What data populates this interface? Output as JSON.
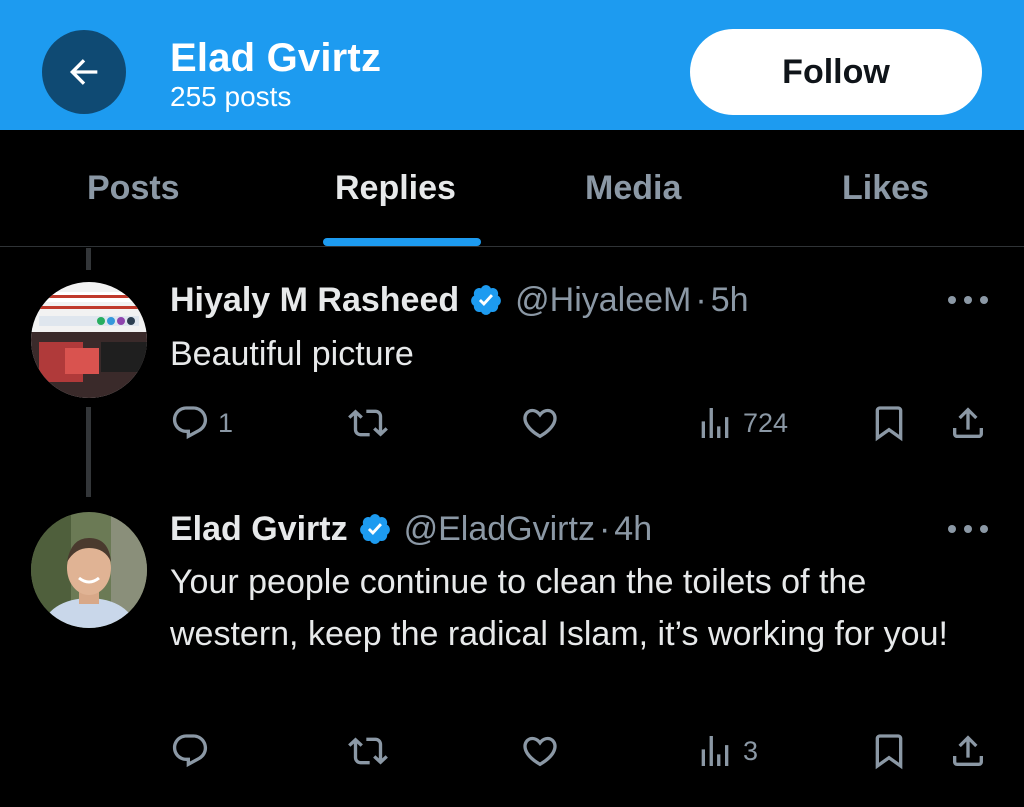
{
  "header": {
    "name": "Elad Gvirtz",
    "post_count": "255 posts",
    "follow_label": "Follow",
    "back_icon": "arrow-left-icon",
    "background": "#1d9bf0"
  },
  "tabs": [
    {
      "label": "Posts",
      "active": false
    },
    {
      "label": "Replies",
      "active": true
    },
    {
      "label": "Media",
      "active": false
    },
    {
      "label": "Likes",
      "active": false
    }
  ],
  "accent": "#1d9bf0",
  "tweets": [
    {
      "name": "Hiyaly M Rasheed",
      "verified": true,
      "handle": "@HiyaleeM",
      "dot": "·",
      "time": "5h",
      "text": "Beautiful picture",
      "replies": "1",
      "reposts": "",
      "likes": "",
      "views": "724"
    },
    {
      "name": "Elad Gvirtz",
      "verified": true,
      "handle": "@EladGvirtz",
      "dot": "·",
      "time": "4h",
      "text": "Your people continue to clean the toilets of the western, keep the radical Islam, it’s working for you!",
      "replies": "",
      "reposts": "",
      "likes": "",
      "views": "3"
    }
  ]
}
